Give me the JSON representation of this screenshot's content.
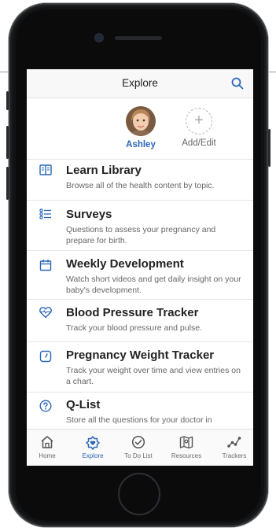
{
  "colors": {
    "accent": "#2a66b8",
    "text": "#222222",
    "muted": "#666666",
    "divider": "#e6e6e6"
  },
  "nav": {
    "title": "Explore",
    "search_icon": "search-icon"
  },
  "profiles": [
    {
      "name": "Ashley",
      "icon": "avatar",
      "active": true
    },
    {
      "name": "Add/Edit",
      "icon": "plus-icon",
      "active": false
    }
  ],
  "items": [
    {
      "title": "Learn Library",
      "desc": "Browse all of the health content by topic.",
      "icon": "book-icon"
    },
    {
      "title": "Surveys",
      "desc": "Questions to assess your pregnancy and prepare for birth.",
      "icon": "list-icon"
    },
    {
      "title": "Weekly Development",
      "desc": "Watch short videos and get daily insight on your baby's development.",
      "icon": "calendar-icon"
    },
    {
      "title": "Blood Pressure Tracker",
      "desc": "Track your blood pressure and pulse.",
      "icon": "heart-pulse-icon"
    },
    {
      "title": "Pregnancy Weight Tracker",
      "desc": "Track your weight over time and view entries on a chart.",
      "icon": "scale-icon"
    },
    {
      "title": "Q-List",
      "desc": "Store all the questions for your doctor in",
      "icon": "question-icon"
    }
  ],
  "tabs": [
    {
      "label": "Home",
      "icon": "home-icon",
      "active": false
    },
    {
      "label": "Explore",
      "icon": "compass-heart-icon",
      "active": true
    },
    {
      "label": "To Do List",
      "icon": "check-circle-icon",
      "active": false
    },
    {
      "label": "Resources",
      "icon": "map-icon",
      "active": false
    },
    {
      "label": "Trackers",
      "icon": "trend-icon",
      "active": false
    }
  ]
}
